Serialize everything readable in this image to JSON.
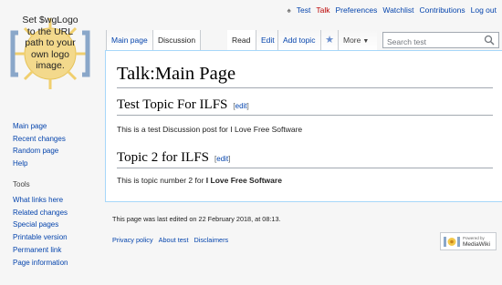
{
  "personal_tools": {
    "username": "Test",
    "talk": "Talk",
    "preferences": "Preferences",
    "watchlist": "Watchlist",
    "contributions": "Contributions",
    "logout": "Log out"
  },
  "logo": {
    "text_lines": [
      "Set $wgLogo",
      "to the URL",
      "path to your",
      "own logo",
      "image."
    ]
  },
  "sidebar": {
    "navigation": [
      "Main page",
      "Recent changes",
      "Random page",
      "Help"
    ],
    "tools_heading": "Tools",
    "tools": [
      "What links here",
      "Related changes",
      "Special pages",
      "Printable version",
      "Permanent link",
      "Page information"
    ]
  },
  "tabs": {
    "main_page": "Main page",
    "discussion": "Discussion",
    "read": "Read",
    "edit": "Edit",
    "add_topic": "Add topic",
    "more": "More"
  },
  "search": {
    "placeholder": "Search test"
  },
  "content": {
    "title": "Talk:Main Page",
    "edit_label": "edit",
    "sections": [
      {
        "heading": "Test Topic For ILFS",
        "text": "This is a test Discussion post for I Love Free Software"
      },
      {
        "heading": "Topic 2 for ILFS",
        "text_before": "This is topic number 2 for ",
        "text_bold": "I Love Free Software"
      }
    ]
  },
  "footer": {
    "last_modified": "This page was last edited on 22 February 2018, at 08:13.",
    "links": [
      "Privacy policy",
      "About test",
      "Disclaimers"
    ],
    "powered_by_line1": "Powered by",
    "powered_by_line2": "MediaWiki"
  }
}
